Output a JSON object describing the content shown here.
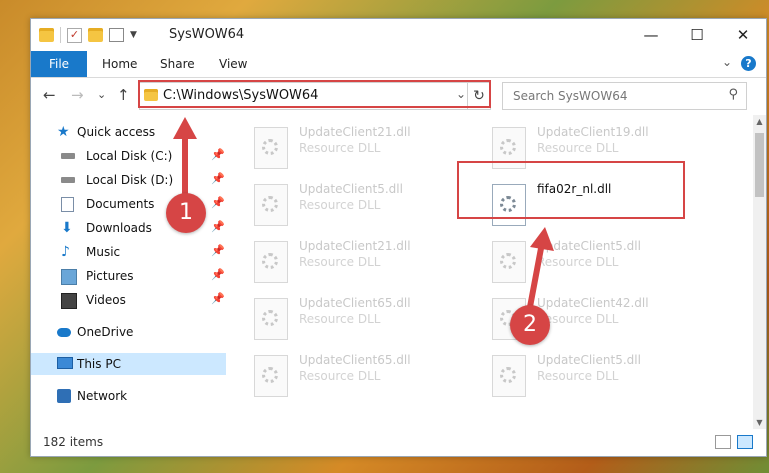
{
  "window": {
    "title": "SysWOW64",
    "controls": {
      "minimize": "—",
      "maximize": "☐",
      "close": "✕"
    }
  },
  "ribbon": {
    "file_tab": "File",
    "tabs": [
      "Home",
      "Share",
      "View"
    ],
    "help": "?"
  },
  "navigation": {
    "back": "←",
    "forward": "→",
    "recent": "⌄",
    "up": "↑",
    "address": "C:\\Windows\\SysWOW64",
    "search_placeholder": "Search SysWOW64"
  },
  "sidebar": {
    "quick_access": "Quick access",
    "items": [
      {
        "label": "Local Disk (C:)",
        "icon": "drive-icon",
        "pinned": true
      },
      {
        "label": "Local Disk (D:)",
        "icon": "drive-icon",
        "pinned": true
      },
      {
        "label": "Documents",
        "icon": "documents-icon",
        "pinned": true
      },
      {
        "label": "Downloads",
        "icon": "downloads-icon",
        "pinned": true
      },
      {
        "label": "Music",
        "icon": "music-icon",
        "pinned": true
      },
      {
        "label": "Pictures",
        "icon": "pictures-icon",
        "pinned": true
      },
      {
        "label": "Videos",
        "icon": "videos-icon",
        "pinned": true
      }
    ],
    "onedrive": "OneDrive",
    "this_pc": "This PC",
    "network": "Network"
  },
  "files": [
    {
      "name": "UpdateClient21.dll",
      "type": "Resource DLL"
    },
    {
      "name": "UpdateClient19.dll",
      "type": "Resource DLL"
    },
    {
      "name": "UpdateClient5.dll",
      "type": "Resource DLL"
    },
    {
      "name": "fifa02r_nl.dll",
      "type": ""
    },
    {
      "name": "UpdateClient21.dll",
      "type": "Resource DLL"
    },
    {
      "name": "UpdateClient5.dll",
      "type": "Resource DLL"
    },
    {
      "name": "UpdateClient65.dll",
      "type": "Resource DLL"
    },
    {
      "name": "UpdateClient42.dll",
      "type": "Resource DLL"
    },
    {
      "name": "UpdateClient65.dll",
      "type": "Resource DLL"
    },
    {
      "name": "UpdateClient5.dll",
      "type": "Resource DLL"
    }
  ],
  "status": {
    "item_count": "182 items"
  },
  "annotations": {
    "step1": "1",
    "step2": "2"
  },
  "colors": {
    "accent": "#1979ca",
    "highlight": "#d64545"
  }
}
